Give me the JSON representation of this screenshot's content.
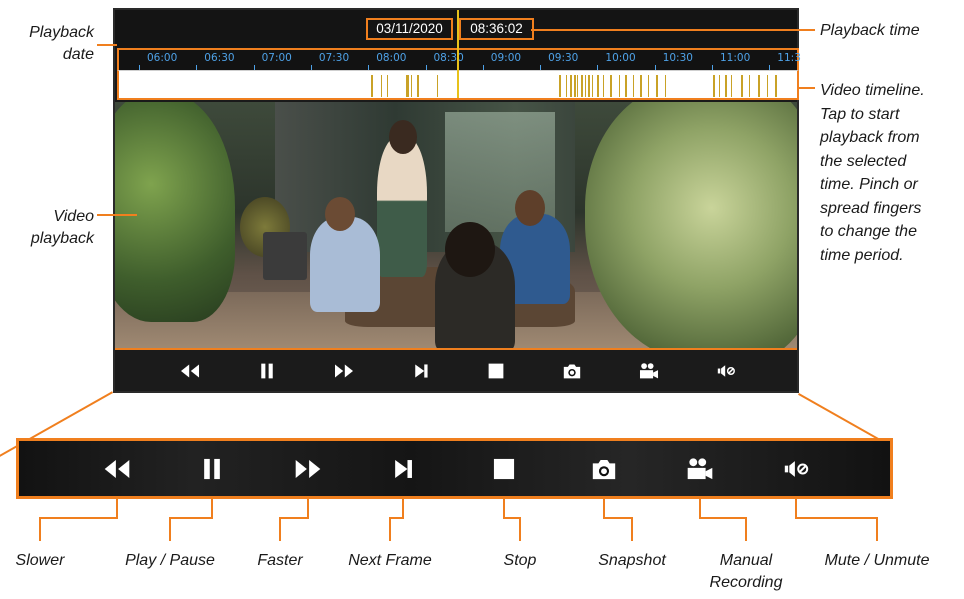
{
  "playback": {
    "date": "03/11/2020",
    "time": "08:36:02"
  },
  "timeline": {
    "ticks": [
      "06:00",
      "06:30",
      "07:00",
      "07:30",
      "08:00",
      "08:30",
      "09:00",
      "09:30",
      "10:00",
      "10:30",
      "11:00",
      "11:3"
    ],
    "playhead": "08:36:02",
    "recording_color": "#c9a227",
    "tick_color": "#4ea1e6"
  },
  "controls": [
    {
      "id": "slower",
      "label": "Slower",
      "icon": "rewind-icon"
    },
    {
      "id": "play-pause",
      "label": "Play / Pause",
      "icon": "pause-icon"
    },
    {
      "id": "faster",
      "label": "Faster",
      "icon": "fast-forward-icon"
    },
    {
      "id": "next-frame",
      "label": "Next Frame",
      "icon": "next-frame-icon"
    },
    {
      "id": "stop",
      "label": "Stop",
      "icon": "stop-icon"
    },
    {
      "id": "snapshot",
      "label": "Snapshot",
      "icon": "camera-icon"
    },
    {
      "id": "manual-recording",
      "label": "Manual\nRecording",
      "icon": "video-camera-icon"
    },
    {
      "id": "mute-unmute",
      "label": "Mute / Unmute",
      "icon": "mute-speaker-icon"
    }
  ],
  "annotations": {
    "playback_date": "Playback\ndate",
    "video_playback": "Video\nplayback",
    "playback_time": "Playback time",
    "video_timeline": "Video timeline.\nTap to start\nplayback from\nthe selected\ntime. Pinch or\nspread fingers\nto change the\ntime period."
  },
  "accent_color": "#f07f1e"
}
